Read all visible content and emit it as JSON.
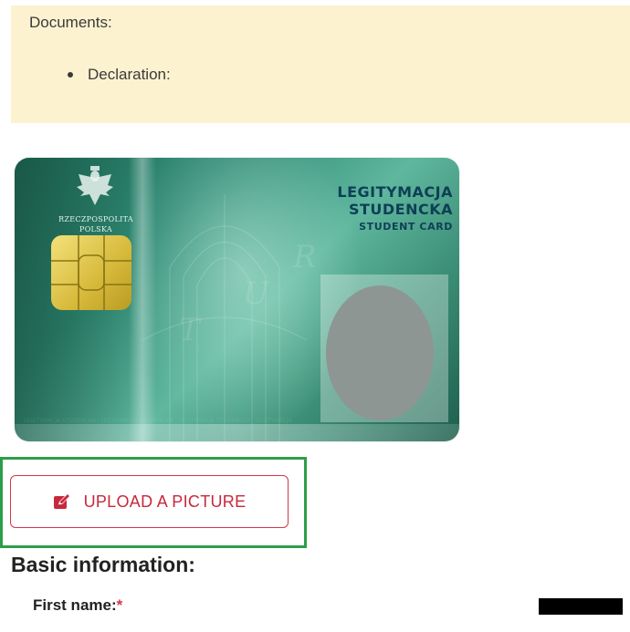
{
  "documents": {
    "title": "Documents:",
    "items": [
      "Declaration:"
    ]
  },
  "card": {
    "issuer_line1": "RZECZPOSPOLITA",
    "issuer_line2": "POLSKA",
    "title_line1": "LEGITYMACJA",
    "title_line2": "STUDENCKA",
    "title_line3": "STUDENT CARD"
  },
  "upload": {
    "label": "UPLOAD A PICTURE",
    "icon": "edit-icon"
  },
  "basic_info": {
    "title": "Basic information:",
    "first_name_label": "First name:",
    "required_mark": "*"
  },
  "colors": {
    "notice_bg": "#fdf2d0",
    "accent_red": "#d4364a",
    "highlight_green": "#2c9e4a"
  }
}
